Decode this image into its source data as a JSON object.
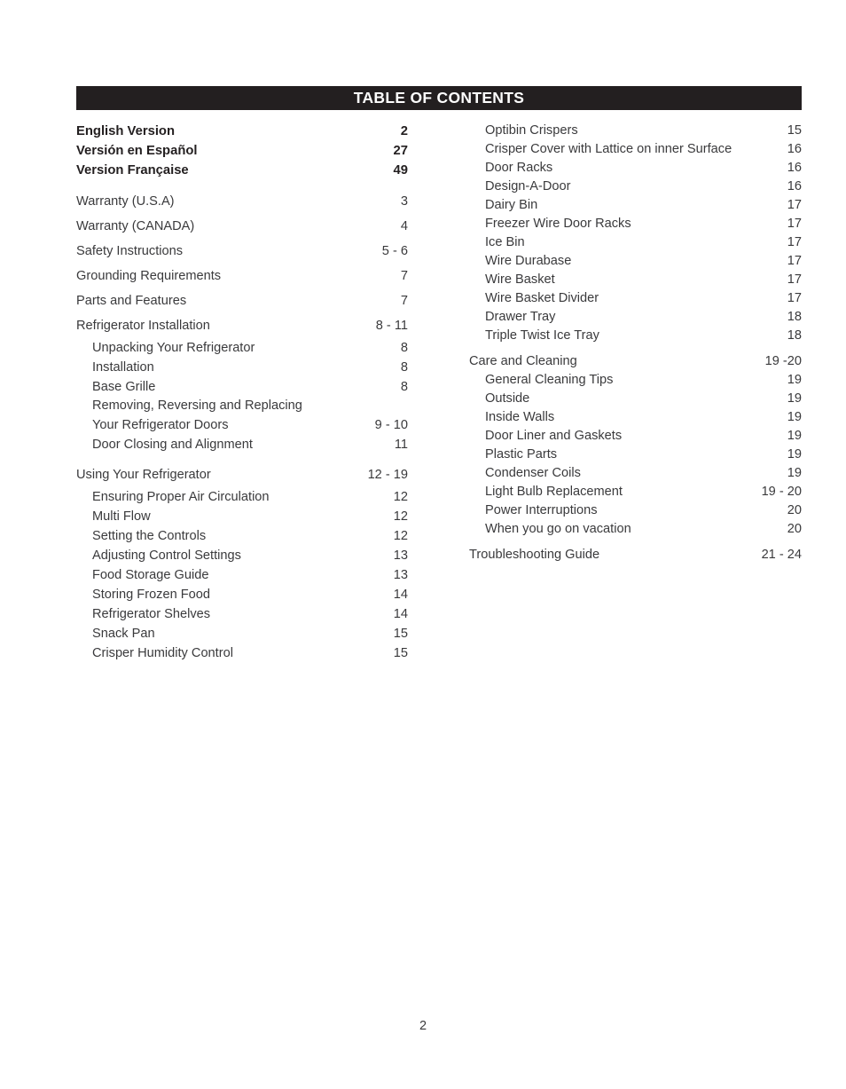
{
  "header": {
    "title": "TABLE OF CONTENTS",
    "bar_color": "#231f20",
    "text_color": "#ffffff"
  },
  "footer": {
    "page_number": "2"
  },
  "left_column": {
    "language_versions": [
      {
        "title": "English Version",
        "pages": "2"
      },
      {
        "title": "Versión en Español",
        "pages": "27"
      },
      {
        "title": "Version Française",
        "pages": "49"
      }
    ],
    "sections": [
      {
        "title": "Warranty (U.S.A)",
        "pages": "3",
        "level": 1,
        "children": []
      },
      {
        "title": "Warranty (CANADA)",
        "pages": "4",
        "level": 1,
        "children": []
      },
      {
        "title": "Safety Instructions",
        "pages": "5 - 6",
        "level": 1,
        "children": []
      },
      {
        "title": "Grounding Requirements",
        "pages": "7",
        "level": 1,
        "children": []
      },
      {
        "title": "Parts and Features",
        "pages": "7",
        "level": 1,
        "children": []
      },
      {
        "title": "Refrigerator Installation",
        "pages": "8 - 11",
        "level": 1,
        "children": [
          {
            "title": "Unpacking Your Refrigerator",
            "pages": "8"
          },
          {
            "title": "Installation",
            "pages": "8"
          },
          {
            "title": "Base Grille",
            "pages": "8"
          },
          {
            "title": "Removing, Reversing and Replacing",
            "pages": "",
            "wrap_first": true
          },
          {
            "title": "Your Refrigerator Doors",
            "pages": "9 - 10",
            "wrap_last": true
          },
          {
            "title": "Door Closing and Alignment",
            "pages": "11"
          }
        ]
      },
      {
        "title": "Using Your Refrigerator",
        "pages": "12 - 19",
        "level": 1,
        "children": [
          {
            "title": "Ensuring Proper Air Circulation",
            "pages": "12"
          },
          {
            "title": "Multi Flow",
            "pages": "12"
          },
          {
            "title": "Setting the Controls",
            "pages": "12"
          },
          {
            "title": "Adjusting Control Settings",
            "pages": "13"
          },
          {
            "title": "Food Storage Guide",
            "pages": "13"
          },
          {
            "title": "Storing Frozen Food",
            "pages": "14"
          },
          {
            "title": "Refrigerator Shelves",
            "pages": "14"
          },
          {
            "title": "Snack Pan",
            "pages": "15"
          },
          {
            "title": "Crisper Humidity Control",
            "pages": "15"
          }
        ]
      }
    ]
  },
  "right_column": {
    "continued_items": [
      {
        "title": "Optibin Crispers",
        "pages": "15"
      },
      {
        "title": "Crisper Cover with Lattice on inner Surface",
        "pages": "16"
      },
      {
        "title": "Door Racks",
        "pages": "16"
      },
      {
        "title": "Design-A-Door",
        "pages": "16"
      },
      {
        "title": "Dairy Bin",
        "pages": "17"
      },
      {
        "title": "Freezer Wire Door Racks",
        "pages": "17"
      },
      {
        "title": "Ice Bin",
        "pages": "17"
      },
      {
        "title": "Wire Durabase",
        "pages": "17"
      },
      {
        "title": "Wire Basket",
        "pages": "17"
      },
      {
        "title": "Wire Basket Divider",
        "pages": "17"
      },
      {
        "title": "Drawer Tray",
        "pages": "18"
      },
      {
        "title": "Triple Twist Ice Tray",
        "pages": "18"
      }
    ],
    "sections": [
      {
        "title": "Care and Cleaning",
        "pages": "19 -20",
        "level": 1,
        "children": [
          {
            "title": "General Cleaning Tips",
            "pages": "19"
          },
          {
            "title": "Outside",
            "pages": "19"
          },
          {
            "title": "Inside Walls",
            "pages": "19"
          },
          {
            "title": "Door Liner and Gaskets",
            "pages": "19"
          },
          {
            "title": "Plastic Parts",
            "pages": "19"
          },
          {
            "title": "Condenser Coils",
            "pages": "19"
          },
          {
            "title": "Light Bulb Replacement",
            "pages": "19 - 20"
          },
          {
            "title": "Power Interruptions",
            "pages": "20"
          },
          {
            "title": "When you go on vacation",
            "pages": "20"
          }
        ]
      },
      {
        "title": "Troubleshooting Guide",
        "pages": "21 - 24",
        "level": 1,
        "children": []
      }
    ]
  }
}
